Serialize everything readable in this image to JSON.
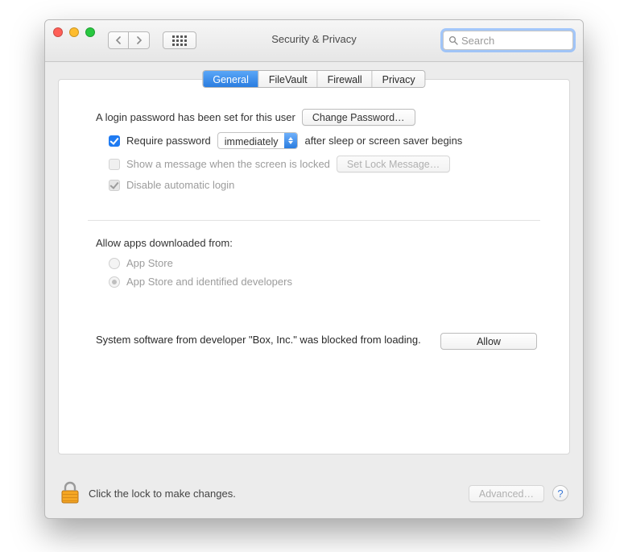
{
  "window": {
    "title": "Security & Privacy"
  },
  "search": {
    "placeholder": "Search"
  },
  "tabs": {
    "general": "General",
    "filevault": "FileVault",
    "firewall": "Firewall",
    "privacy": "Privacy"
  },
  "general": {
    "login_password_set": "A login password has been set for this user",
    "change_password": "Change Password…",
    "require_password_pre": "Require password",
    "require_password_delay": "immediately",
    "require_password_post": "after sleep or screen saver begins",
    "show_message": "Show a message when the screen is locked",
    "set_lock_message": "Set Lock Message…",
    "disable_auto_login": "Disable automatic login"
  },
  "gatekeeper": {
    "label": "Allow apps downloaded from:",
    "app_store": "App Store",
    "identified": "App Store and identified developers"
  },
  "blocked": {
    "message": "System software from developer \"Box, Inc.\" was blocked from loading.",
    "allow": "Allow"
  },
  "footer": {
    "lock_text": "Click the lock to make changes.",
    "advanced": "Advanced…",
    "help": "?"
  }
}
